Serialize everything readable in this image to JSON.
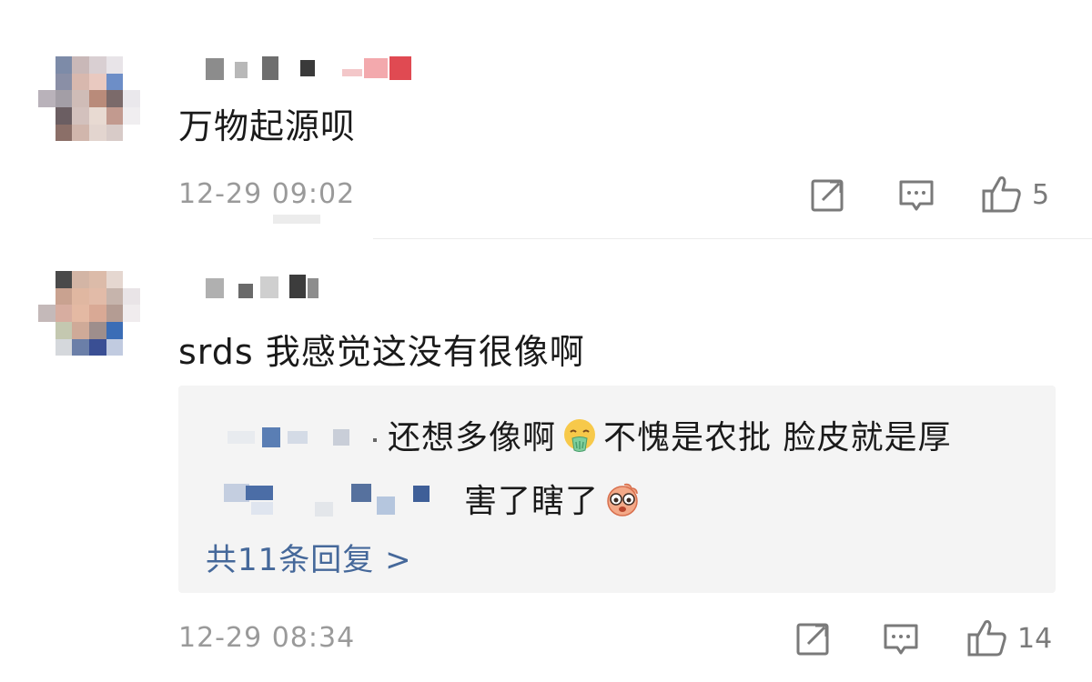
{
  "comments": [
    {
      "text": "万物起源呗",
      "timestamp": "12-29 09:02",
      "likes": "5"
    },
    {
      "text": "srds 我感觉这没有很像啊",
      "timestamp": "12-29 08:34",
      "likes": "14",
      "replies": [
        {
          "text": "还想多像啊",
          "emoji": "vomit-face",
          "text_after": "不愧是农批 脸皮就是厚"
        },
        {
          "text": "害了瞎了",
          "emoji": "cute-pig-face"
        }
      ],
      "view_replies": "共11条回复 >"
    }
  ],
  "icons": {
    "forward": "forward-icon",
    "reply": "comment-icon",
    "like": "like-icon"
  },
  "colors": {
    "text": "#1a1a1a",
    "meta": "#9a9a9a",
    "link": "#45689a",
    "reply_bg": "#f4f4f4"
  }
}
